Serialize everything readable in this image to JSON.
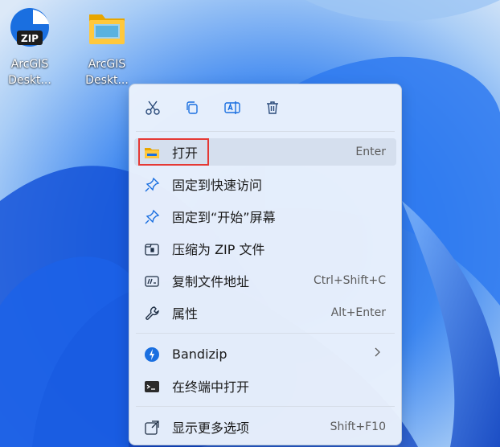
{
  "desktop": {
    "icons": [
      {
        "label": "ArcGIS\nDeskt...",
        "icon": "zip-archive-icon"
      },
      {
        "label": "ArcGIS\nDeskt...",
        "icon": "folder-icon"
      }
    ]
  },
  "toolbar": {
    "buttons": [
      "cut-icon",
      "copy-icon",
      "rename-icon",
      "delete-icon"
    ]
  },
  "menu": {
    "open": {
      "label": "打开",
      "shortcut": "Enter"
    },
    "pin_quick": {
      "label": "固定到快速访问"
    },
    "pin_start": {
      "label": "固定到“开始”屏幕"
    },
    "zip": {
      "label": "压缩为 ZIP 文件"
    },
    "copy_path": {
      "label": "复制文件地址",
      "shortcut": "Ctrl+Shift+C"
    },
    "properties": {
      "label": "属性",
      "shortcut": "Alt+Enter"
    },
    "bandizip": {
      "label": "Bandizip"
    },
    "terminal": {
      "label": "在终端中打开"
    },
    "more": {
      "label": "显示更多选项",
      "shortcut": "Shift+F10"
    }
  },
  "colors": {
    "accent": "#1a6fe0",
    "highlight_box": "#e53935"
  }
}
